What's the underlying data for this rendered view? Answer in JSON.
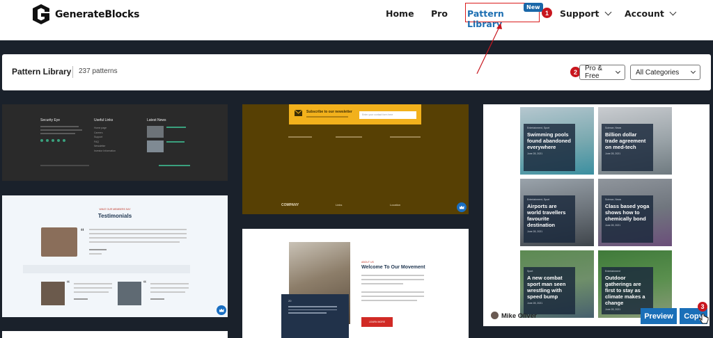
{
  "brand": {
    "name": "GenerateBlocks"
  },
  "nav": {
    "home": "Home",
    "pro": "Pro",
    "pattern_library": "Pattern Library",
    "new_badge": "New",
    "support": "Support",
    "account": "Account"
  },
  "markers": {
    "one": "1",
    "two": "2",
    "three": "3"
  },
  "library": {
    "title": "Pattern Library",
    "count": "237 patterns",
    "filter_plan": "Pro & Free",
    "filter_category": "All Categories"
  },
  "footer_pattern": {
    "brand": "Security Eye",
    "col_links": "Useful Links",
    "col_news": "Latest News",
    "links": [
      "Home page",
      "Careers",
      "Support",
      "FAQ",
      "Newsletter",
      "Investor Information"
    ]
  },
  "testimonials": {
    "kicker": "WHAT OUR MEMBERS SAY",
    "title": "Testimonials"
  },
  "newsletter": {
    "title": "Subscribe to our newsletter",
    "placeholder": "Enter your contact form here",
    "company": "COMPANY",
    "links": "Links",
    "location": "Location"
  },
  "movement": {
    "kicker": "ABOUT US",
    "title": "Welcome To Our Movement",
    "button": "LEARN MORE",
    "quote_label": "20"
  },
  "blog": {
    "posts": [
      {
        "category": "Entertainment, Sport",
        "title": "Swimming pools found abandoned everywhere",
        "date": "June 28, 2021"
      },
      {
        "category": "Science, News",
        "title": "Billion dollar trade agreement on med-tech",
        "date": "June 28, 2021"
      },
      {
        "category": "Entertainment, Sport",
        "title": "Airports are world travellers favourite destination",
        "date": "June 28, 2021"
      },
      {
        "category": "Science, News",
        "title": "Class based yoga shows how to chemically bond",
        "date": "June 28, 2021"
      },
      {
        "category": "Sport",
        "title": "A new combat sport man seen wrestling with speed bump",
        "date": "June 28, 2021"
      },
      {
        "category": "Entertainment",
        "title": "Outdoor gatherings are first to stay as climate makes a change",
        "date": "June 28, 2021"
      }
    ],
    "author": "Mike Oliver",
    "preview_label": "Preview",
    "copy_label": "Copy"
  },
  "colors": {
    "accent": "#1a6fb8",
    "marker": "#c8161e",
    "page_bg": "#1a212b"
  },
  "icons": [
    "logo-mark-icon",
    "chevron-down-icon",
    "crown-icon",
    "mail-icon",
    "quote-icon",
    "cursor-hand-icon"
  ]
}
